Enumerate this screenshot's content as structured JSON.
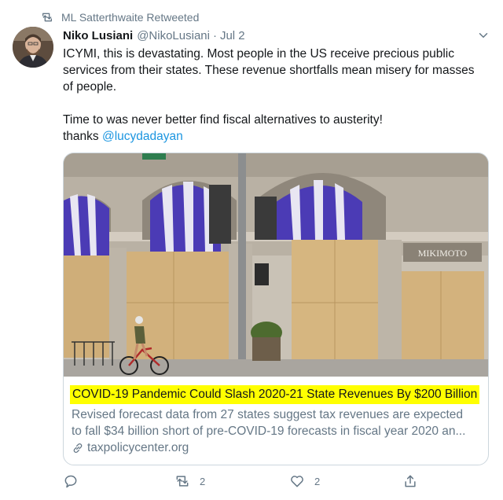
{
  "retweet": {
    "icon": "retweet-icon",
    "label": "ML Satterthwaite Retweeted"
  },
  "tweet": {
    "author_name": "Niko Lusiani",
    "handle": "@NikoLusiani",
    "separator": "·",
    "date": "Jul 2",
    "text_line1": "ICYMI, this is devastating. Most people in the US receive precious public",
    "text_line2": "services from their states. These revenue shortfalls mean misery for masses",
    "text_line3": "of people.",
    "text_line4": "Time to was never better find fiscal alternatives to austerity!",
    "text_thanks": "thanks ",
    "mention": "@lucydadayan"
  },
  "card": {
    "image_sign": "MIKIMOTO",
    "title": "COVID-19 Pandemic Could Slash 2020-21 State Revenues By $200 Billion",
    "desc_line1": "Revised forecast data from 27 states suggest tax revenues are expected",
    "desc_line2": "to fall $34 billion short of pre-COVID-19 forecasts in fiscal year 2020 an...",
    "domain": "taxpolicycenter.org",
    "highlight_color": "#ffff00"
  },
  "actions": {
    "reply_icon": "reply-icon",
    "retweet_icon": "retweet-icon",
    "retweet_count": "2",
    "like_icon": "heart-icon",
    "like_count": "2",
    "share_icon": "share-icon"
  },
  "colors": {
    "accent": "#1b95e0",
    "secondary_text": "#657786",
    "border": "#ccd6dd"
  }
}
